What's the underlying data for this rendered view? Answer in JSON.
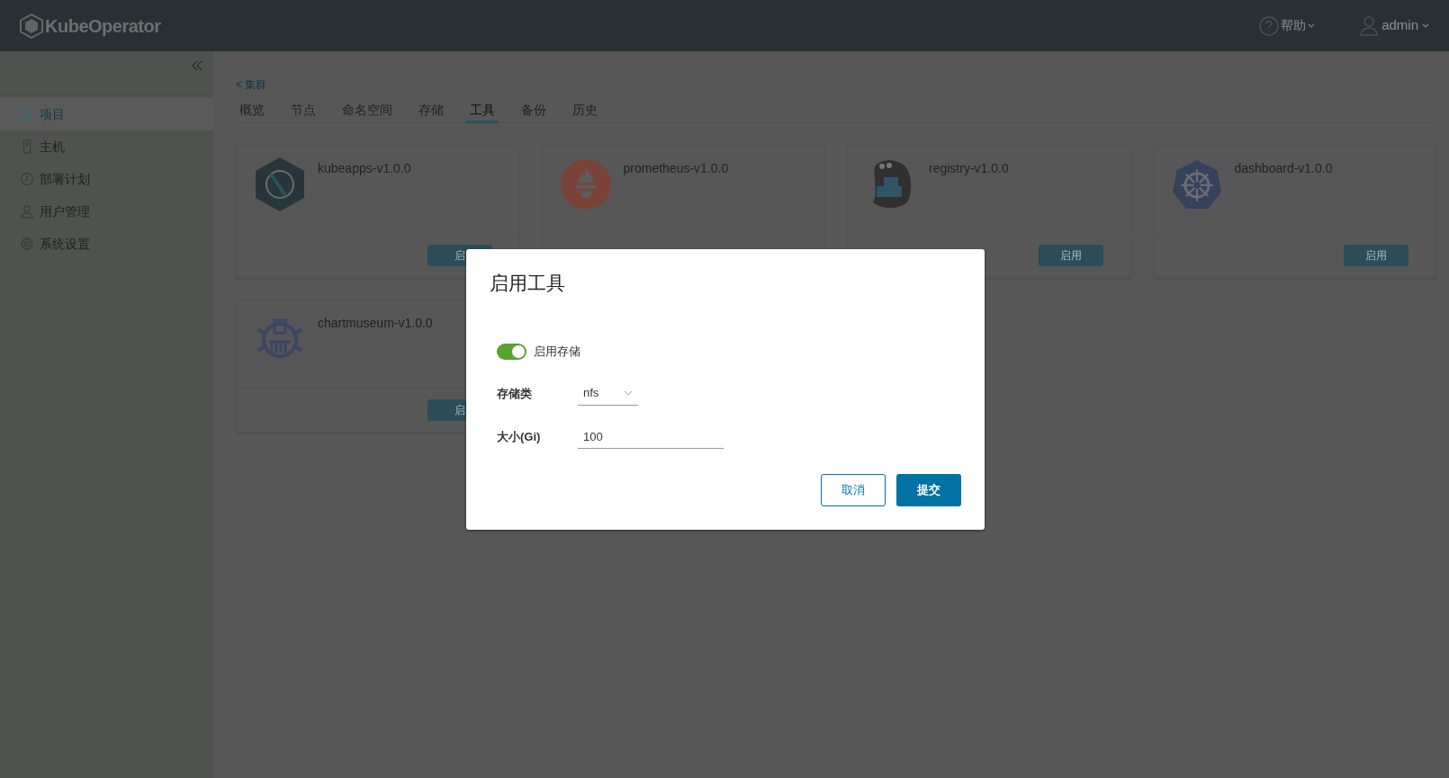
{
  "header": {
    "brand": "KubeOperator",
    "help": "帮助",
    "user": "admin"
  },
  "sidebar": {
    "items": [
      {
        "label": "项目",
        "selected": true
      },
      {
        "label": "主机",
        "selected": false
      },
      {
        "label": "部署计划",
        "selected": false
      },
      {
        "label": "用户管理",
        "selected": false
      },
      {
        "label": "系统设置",
        "selected": false
      }
    ]
  },
  "breadcrumb": "< 集群",
  "tabs": [
    {
      "label": "概览",
      "selected": false
    },
    {
      "label": "节点",
      "selected": false
    },
    {
      "label": "命名空间",
      "selected": false
    },
    {
      "label": "存储",
      "selected": false
    },
    {
      "label": "工具",
      "selected": true
    },
    {
      "label": "备份",
      "selected": false
    },
    {
      "label": "历史",
      "selected": false
    }
  ],
  "tools": [
    {
      "name": "kubeapps-v1.0.0",
      "button": "启"
    },
    {
      "name": "prometheus-v1.0.0"
    },
    {
      "name": "registry-v1.0.0",
      "button": "启用"
    },
    {
      "name": "dashboard-v1.0.0",
      "button": "启用"
    },
    {
      "name": "chartmuseum-v1.0.0",
      "button": "启"
    }
  ],
  "modal": {
    "title": "启用工具",
    "fields": [
      {
        "kind": "switch",
        "label": "启用存储",
        "on": true
      },
      {
        "kind": "select",
        "label": "存储类",
        "value": "nfs"
      },
      {
        "kind": "input",
        "label": "大小(Gi)",
        "value": "100"
      }
    ],
    "cancel": "取消",
    "submit": "提交"
  }
}
